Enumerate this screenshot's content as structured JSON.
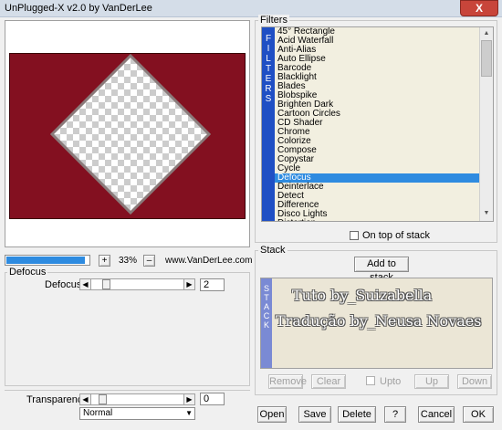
{
  "window": {
    "title": "UnPlugged-X v2.0 by VanDerLee",
    "close_glyph": "X"
  },
  "preview": {
    "background_color": "#831020"
  },
  "zoom": {
    "plus": "+",
    "minus": "–",
    "value": "33%",
    "progress_fraction": 0.95
  },
  "website": "www.VanDerLee.com",
  "defocus_group": {
    "title": "Defocus",
    "param_label": "Defocus",
    "param_value": "2",
    "param_fraction": 0.15
  },
  "transparency": {
    "label": "Transparency",
    "value": "0",
    "fraction": 0.1,
    "blend_selected": "Normal"
  },
  "filters": {
    "title": "Filters",
    "strip_letters": [
      "F",
      "I",
      "L",
      "T",
      "E",
      "R",
      "S"
    ],
    "items": [
      "45° Rectangle",
      "Acid Waterfall",
      "Anti-Alias",
      "Auto Ellipse",
      "Barcode",
      "Blacklight",
      "Blades",
      "Blobspike",
      "Brighten Dark",
      "Cartoon Circles",
      "CD Shader",
      "Chrome",
      "Colorize",
      "Compose",
      "Copystar",
      "Cycle",
      "Defocus",
      "Deinterlace",
      "Detect",
      "Difference",
      "Disco Lights",
      "Distortion"
    ],
    "selected_index": 16,
    "on_top_label": "On top of stack",
    "selected_color": "#2e8be0"
  },
  "stack": {
    "title": "Stack",
    "add_label": "Add to stack",
    "strip_letters": [
      "S",
      "T",
      "A",
      "C",
      "K"
    ],
    "watermark_line1": "Tuto by_Suizabella",
    "watermark_line2": "Tradução by_Neusa Novaes",
    "remove_label": "Remove",
    "clear_label": "Clear",
    "upto_label": "Upto",
    "up_label": "Up",
    "down_label": "Down"
  },
  "footer": {
    "open": "Open",
    "save": "Save",
    "delete": "Delete",
    "help": "?",
    "cancel": "Cancel",
    "ok": "OK"
  }
}
